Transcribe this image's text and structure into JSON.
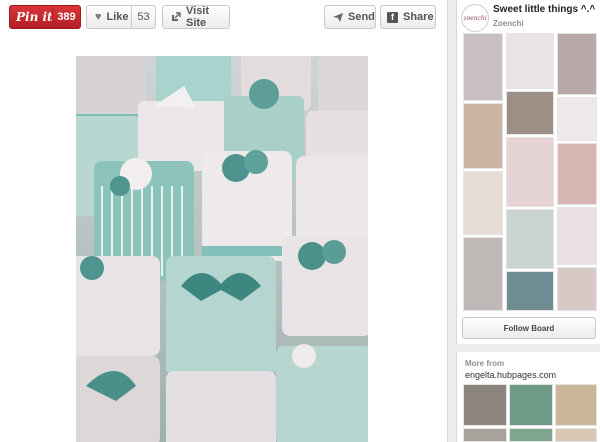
{
  "actions": {
    "pinit_label": "Pin it",
    "pinit_count": "389",
    "like_label": "Like",
    "like_count": "53",
    "visit_label": "Visit Site",
    "send_label": "Send",
    "share_label": "Share"
  },
  "board": {
    "title": "Sweet little things ^.^",
    "owner": "Zoenchi",
    "avatar_text": "zoenchi",
    "follow_label": "Follow Board"
  },
  "more": {
    "heading": "More from",
    "source": "engelta.hubpages.com"
  },
  "colors": {
    "pinit_red": "#c8232c",
    "mint": "#7fbdb7",
    "cake_white": "#e9e6e6"
  }
}
